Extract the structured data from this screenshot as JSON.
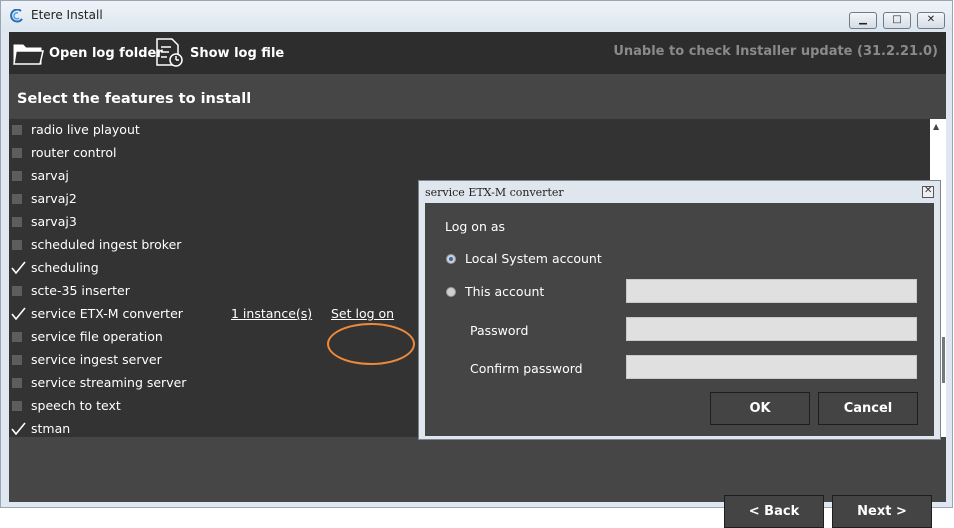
{
  "window": {
    "title": "Etere Install"
  },
  "titlebar": {
    "minimize": "▭",
    "maximize": "□",
    "close": "✕"
  },
  "toolbar": {
    "open_log_folder": "Open log folder",
    "show_log_file": "Show log file",
    "update_status": "Unable to check Installer update (31.2.21.0)"
  },
  "section_title": "Select the features to install",
  "features": [
    {
      "label": "radio live playout",
      "checked": false
    },
    {
      "label": "router control",
      "checked": false
    },
    {
      "label": "sarvaj",
      "checked": false
    },
    {
      "label": "sarvaj2",
      "checked": false
    },
    {
      "label": "sarvaj3",
      "checked": false
    },
    {
      "label": "scheduled ingest broker",
      "checked": false
    },
    {
      "label": "scheduling",
      "checked": true
    },
    {
      "label": "scte-35 inserter",
      "checked": false
    },
    {
      "label": "service ETX-M converter",
      "checked": true,
      "instances": "1 instance(s)",
      "logon": "Set log on"
    },
    {
      "label": "service file operation",
      "checked": false
    },
    {
      "label": "service ingest server",
      "checked": false
    },
    {
      "label": "service streaming server",
      "checked": false
    },
    {
      "label": "speech to text",
      "checked": false
    },
    {
      "label": "stman",
      "checked": true
    }
  ],
  "dialog": {
    "title": "service ETX-M converter",
    "logon_as": "Log on as",
    "local_system": "Local System account",
    "this_account": "This account",
    "password": "Password",
    "confirm_password": "Confirm password",
    "ok": "OK",
    "cancel": "Cancel",
    "selected_option": "Local System account"
  },
  "nav": {
    "back": "< Back",
    "next": "Next >"
  },
  "colors": {
    "highlight": "#ee8a3a",
    "background": "#464646",
    "list_background": "#333333",
    "toolbar": "#2d2d2d"
  }
}
